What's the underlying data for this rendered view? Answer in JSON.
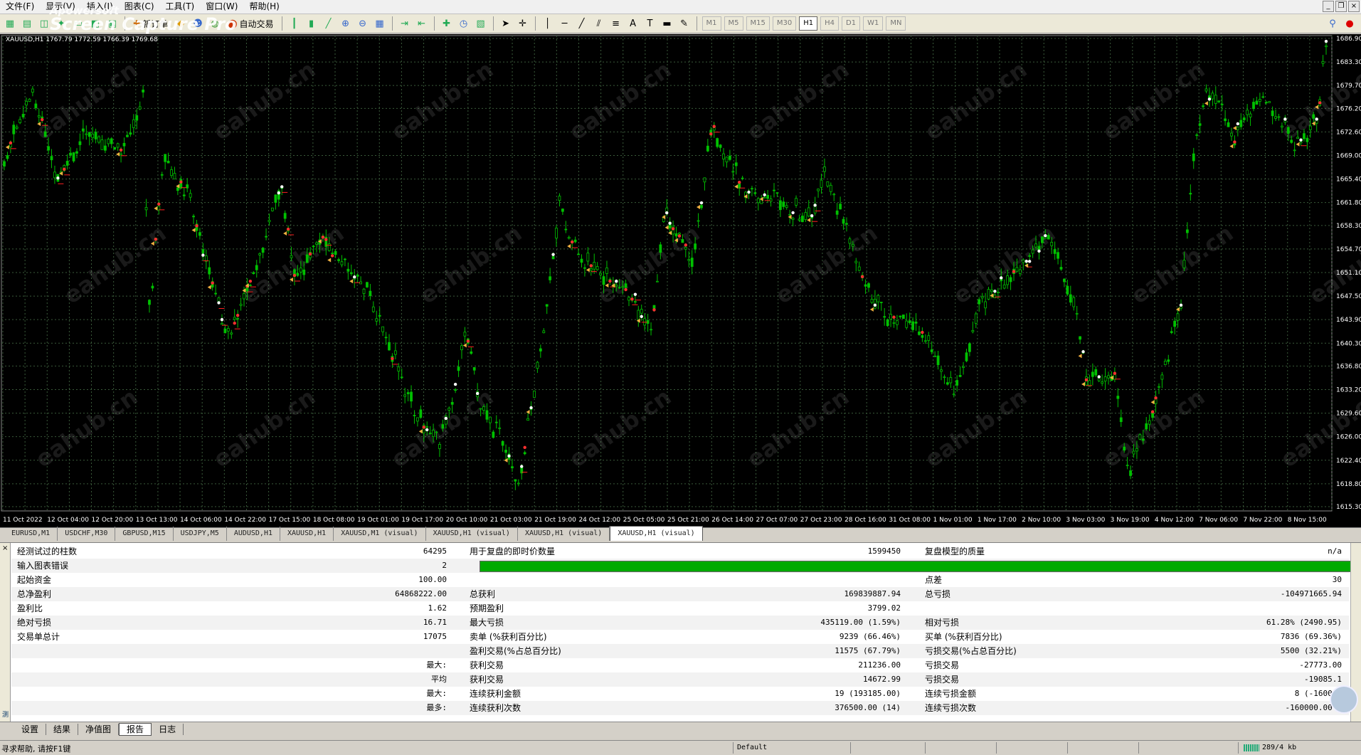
{
  "menu": [
    "文件(F)",
    "显示(V)",
    "插入(I)",
    "图表(C)",
    "工具(T)",
    "窗口(W)",
    "帮助(H)"
  ],
  "watermark": {
    "line1": "Apowersoft",
    "line2": "Screen Capture Pro"
  },
  "toolbar": {
    "new_order": "新订单",
    "auto_trade": "自动交易",
    "timeframes": [
      "M1",
      "M5",
      "M15",
      "M30",
      "H1",
      "H4",
      "D1",
      "W1",
      "MN"
    ],
    "active_tf": "H1"
  },
  "chart": {
    "title": "XAUUSD,H1  1767.79 1772.59 1766.39 1769.68",
    "price_labels": [
      "1686.90",
      "1683.30",
      "1679.70",
      "1676.20",
      "1672.60",
      "1669.00",
      "1665.40",
      "1661.80",
      "1658.30",
      "1654.70",
      "1651.10",
      "1647.50",
      "1643.90",
      "1640.30",
      "1636.80",
      "1633.20",
      "1629.60",
      "1626.00",
      "1622.40",
      "1618.80",
      "1615.30"
    ],
    "time_labels": [
      "11 Oct 2022",
      "12 Oct 04:00",
      "12 Oct 20:00",
      "13 Oct 13:00",
      "14 Oct 06:00",
      "14 Oct 22:00",
      "17 Oct 15:00",
      "18 Oct 08:00",
      "19 Oct 01:00",
      "19 Oct 17:00",
      "20 Oct 10:00",
      "21 Oct 03:00",
      "21 Oct 19:00",
      "24 Oct 12:00",
      "25 Oct 05:00",
      "25 Oct 21:00",
      "26 Oct 14:00",
      "27 Oct 07:00",
      "27 Oct 23:00",
      "28 Oct 16:00",
      "31 Oct 08:00",
      "1 Nov 01:00",
      "1 Nov 17:00",
      "2 Nov 10:00",
      "3 Nov 03:00",
      "3 Nov 19:00",
      "4 Nov 12:00",
      "7 Nov 06:00",
      "7 Nov 22:00",
      "8 Nov 15:00"
    ],
    "watermark_text": "eahub.cn",
    "colors": {
      "bg": "#000000",
      "grid": "#3a5a3a",
      "candle": "#00c000",
      "axis_text": "#ffffff"
    }
  },
  "chart_tabs": [
    "EURUSD,M1",
    "USDCHF,M30",
    "GBPUSD,M15",
    "USDJPY,M5",
    "AUDUSD,H1",
    "XAUUSD,H1",
    "XAUUSD,M1 (visual)",
    "XAUUSD,H1 (visual)",
    "XAUUSD,H1 (visual)",
    "XAUUSD,H1 (visual)"
  ],
  "active_chart_tab": 9,
  "report": {
    "r1": {
      "a": "经测试过的柱数",
      "av": "64295",
      "b": "用于复盘的即时价数量",
      "bv": "1599450",
      "c": "复盘模型的质量",
      "cv": "n/a"
    },
    "r2": {
      "a": "输入图表错误",
      "av": "2",
      "progress": 1.0
    },
    "r3": {
      "a": "起始资金",
      "av": "100.00",
      "c": "点差",
      "cv": "30"
    },
    "r4": {
      "a": "总净盈利",
      "av": "64868222.00",
      "b": "总获利",
      "bv": "169839887.94",
      "c": "总亏损",
      "cv": "-104971665.94"
    },
    "r5": {
      "a": "盈利比",
      "av": "1.62",
      "b": "预期盈利",
      "bv": "3799.02"
    },
    "r6": {
      "a": "绝对亏损",
      "av": "16.71",
      "b": "最大亏损",
      "bv": "435119.00 (1.59%)",
      "c": "相对亏损",
      "cv": "61.28% (2490.95)"
    },
    "r7": {
      "a": "交易单总计",
      "av": "17075",
      "b": "卖单 (%获利百分比)",
      "bv": "9239 (66.46%)",
      "c": "买单 (%获利百分比)",
      "cv": "7836 (69.36%)"
    },
    "r8": {
      "b": "盈利交易(%占总百分比)",
      "bv": "11575 (67.79%)",
      "c": "亏损交易(%占总百分比)",
      "cv": "5500 (32.21%)"
    },
    "r9": {
      "m": "最大:",
      "b": "获利交易",
      "bv": "211236.00",
      "c": "亏损交易",
      "cv": "-27773.00"
    },
    "r10": {
      "m": "平均",
      "b": "获利交易",
      "bv": "14672.99",
      "c": "亏损交易",
      "cv": "-19085.1"
    },
    "r11": {
      "m": "最大:",
      "b": "连续获利金额",
      "bv": "19 (193185.00)",
      "c": "连续亏损金额",
      "cv": "8 (-160000"
    },
    "r12": {
      "m": "最多:",
      "b": "连续获利次数",
      "bv": "376500.00 (14)",
      "c": "连续亏损次数",
      "cv": "-160000.00 ("
    },
    "side_label": "测试器"
  },
  "bottom_tabs": [
    "设置",
    "结果",
    "净值图",
    "报告",
    "日志"
  ],
  "active_bottom_tab": 3,
  "status": {
    "help": "寻求帮助, 请按F1键",
    "profile": "Default",
    "traffic": "289/4 kb"
  }
}
